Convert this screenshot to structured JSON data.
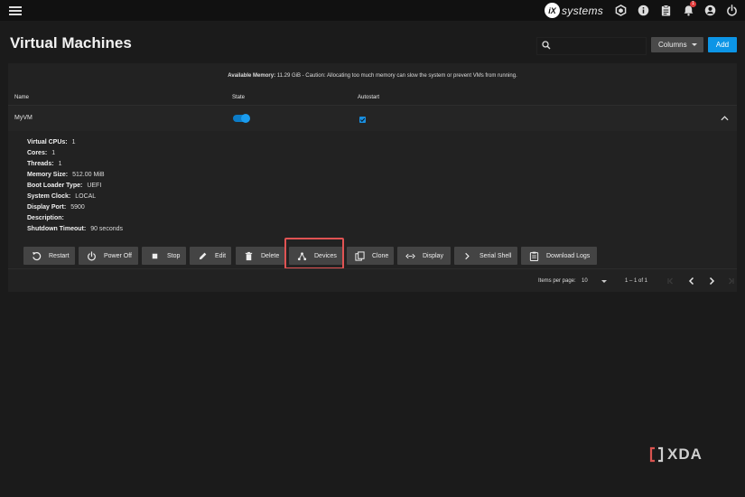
{
  "topbar": {
    "brand_mark": "iX",
    "brand_text": "systems",
    "notification_count": "1",
    "icons": [
      "truecommand-icon",
      "info-icon",
      "clipboard-icon",
      "bell-icon",
      "account-icon",
      "power-icon"
    ]
  },
  "page": {
    "title": "Virtual Machines"
  },
  "search": {
    "placeholder": "",
    "value": ""
  },
  "toolbar": {
    "columns_label": "Columns",
    "add_label": "Add"
  },
  "memory_note": {
    "label": "Available Memory:",
    "text": " 11.29 GiB - Caution: Allocating too much memory can slow the system or prevent VMs from running."
  },
  "table": {
    "headers": {
      "name": "Name",
      "state": "State",
      "autostart": "Autostart"
    },
    "row": {
      "name": "MyVM",
      "state_on": true,
      "autostart_checked": true
    }
  },
  "details": [
    {
      "key": "Virtual CPUs:",
      "value": "1"
    },
    {
      "key": "Cores:",
      "value": "1"
    },
    {
      "key": "Threads:",
      "value": "1"
    },
    {
      "key": "Memory Size:",
      "value": "512.00 MiB"
    },
    {
      "key": "Boot Loader Type:",
      "value": "UEFI"
    },
    {
      "key": "System Clock:",
      "value": "LOCAL"
    },
    {
      "key": "Display Port:",
      "value": "5900"
    },
    {
      "key": "Description:",
      "value": ""
    },
    {
      "key": "Shutdown Timeout:",
      "value": "90 seconds"
    }
  ],
  "actions": [
    {
      "label": "Restart",
      "icon": "restart-icon"
    },
    {
      "label": "Power Off",
      "icon": "power-icon"
    },
    {
      "label": "Stop",
      "icon": "stop-icon"
    },
    {
      "label": "Edit",
      "icon": "pencil-icon"
    },
    {
      "label": "Delete",
      "icon": "trash-icon"
    },
    {
      "label": "Devices",
      "icon": "devices-icon"
    },
    {
      "label": "Clone",
      "icon": "clone-icon"
    },
    {
      "label": "Display",
      "icon": "code-arrows-icon"
    },
    {
      "label": "Serial Shell",
      "icon": "chevron-right-icon"
    },
    {
      "label": "Download Logs",
      "icon": "clipboard-icon"
    }
  ],
  "pagination": {
    "items_per_page_label": "Items per page:",
    "items_per_page_value": "10",
    "range": "1 – 1 of 1"
  },
  "watermark": {
    "text": "XDA"
  },
  "colors": {
    "accent": "#0c95e6",
    "highlight": "#e05353",
    "background": "#1b1b1b",
    "panel": "#222222",
    "button": "#444444"
  }
}
